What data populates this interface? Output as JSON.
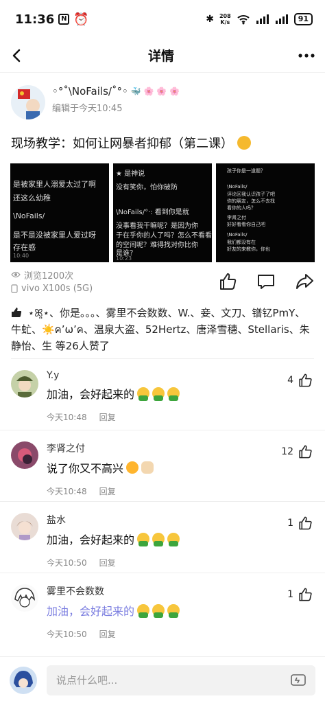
{
  "status": {
    "time": "11:36",
    "speed_top": "208",
    "speed_unit": "K/s",
    "battery": "91"
  },
  "nav": {
    "title": "详情"
  },
  "author": {
    "name": "◦°˚\\NoFails/˚°◦",
    "edited": "编辑于今天10:45"
  },
  "post": {
    "text": "现场教学：如何让网暴者抑郁（第二课）"
  },
  "images": [
    {
      "lines": [
        "是被家里人溺爱太过了啊",
        "还这么幼稚",
        "\\NoFails/",
        "是不是没被家里人爱过呀",
        "存在感",
        "10:40"
      ]
    },
    {
      "lines": [
        "★ 是神说",
        "没有笑你，怕你破防",
        "\\NoFails/°·: 看到你是就",
        "没事看我干嘛呢？是因为你",
        "于在乎你的人了吗？怎么不看看",
        "的空间呢？难得找对你比你",
        "是谁？",
        "10:23"
      ]
    },
    {
      "lines": [
        "孩子你是一道题？",
        "\\NoFails/",
        "评论区我认识孩子了吧",
        "你的朋友，怎么不去找",
        "看你的人吗？",
        "李肾之付",
        "好好看看你自己吧",
        "\\NoFails/",
        "我们都没有在",
        "好友的来教你，你也"
      ]
    }
  ],
  "meta": {
    "views": "浏览1200次",
    "device": "vivo X100s (5G)"
  },
  "likes": {
    "text": "⋆ꕤ̤⋆、你是。。。、雾里不会数数、W.、妾、文刀、镨钇PmY、牛虻、☀️ค’ω’ค、温泉大盗、52Hertz、唐泽雪穗、Stellaris、朱静怡、生 等26人赞了"
  },
  "comments": [
    {
      "name": "Y.y",
      "text": "加油，会好起来的",
      "time": "今天10:48",
      "reply": "回复",
      "likes": "4"
    },
    {
      "name": "李肾之付",
      "text": "说了你又不高兴",
      "time": "今天10:48",
      "reply": "回复",
      "likes": "12"
    },
    {
      "name": "盐水",
      "text": "加油，会好起来的",
      "time": "今天10:50",
      "reply": "回复",
      "likes": "1"
    },
    {
      "name": "雾里不会数数",
      "text": "加油，会好起来的",
      "time": "今天10:50",
      "reply": "回复",
      "likes": "1"
    }
  ],
  "input": {
    "placeholder": "说点什么吧..."
  }
}
